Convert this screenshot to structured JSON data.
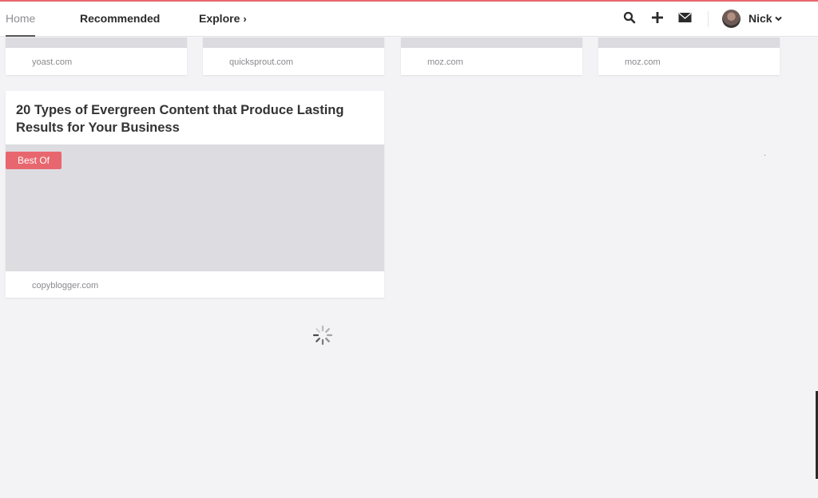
{
  "nav": {
    "home": "Home",
    "recommended": "Recommended",
    "explore": "Explore",
    "explore_chevron": "›",
    "user_name": "Nick",
    "icons": [
      "search-icon",
      "plus-icon",
      "mail-icon",
      "chevron-down-icon"
    ]
  },
  "top_cards": [
    {
      "source": "yoast.com"
    },
    {
      "source": "quicksprout.com"
    },
    {
      "source": "moz.com"
    },
    {
      "source": "moz.com"
    }
  ],
  "feature": {
    "title": "20 Types of Evergreen Content that Produce Lasting Results for Your Business",
    "badge": "Best Of",
    "source": "copyblogger.com"
  },
  "colors": {
    "accent": "#e8676f",
    "background": "#f3f2f5",
    "image_placeholder": "#dddce1"
  }
}
